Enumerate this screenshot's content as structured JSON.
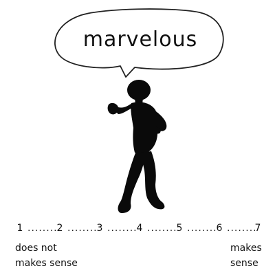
{
  "speech_bubble": {
    "text": "marvelous"
  },
  "scale": {
    "points": [
      "1",
      "2",
      "3",
      "4",
      "5",
      "6",
      "7"
    ],
    "separator": "........",
    "low_anchor": {
      "line1": "does not",
      "line2": "makes sense"
    },
    "high_anchor": {
      "line1": "makes",
      "line2": "sense"
    }
  },
  "colors": {
    "ink": "#111111",
    "background": "#ffffff"
  },
  "icons": {
    "figure": "dancing-silhouette-icon"
  }
}
